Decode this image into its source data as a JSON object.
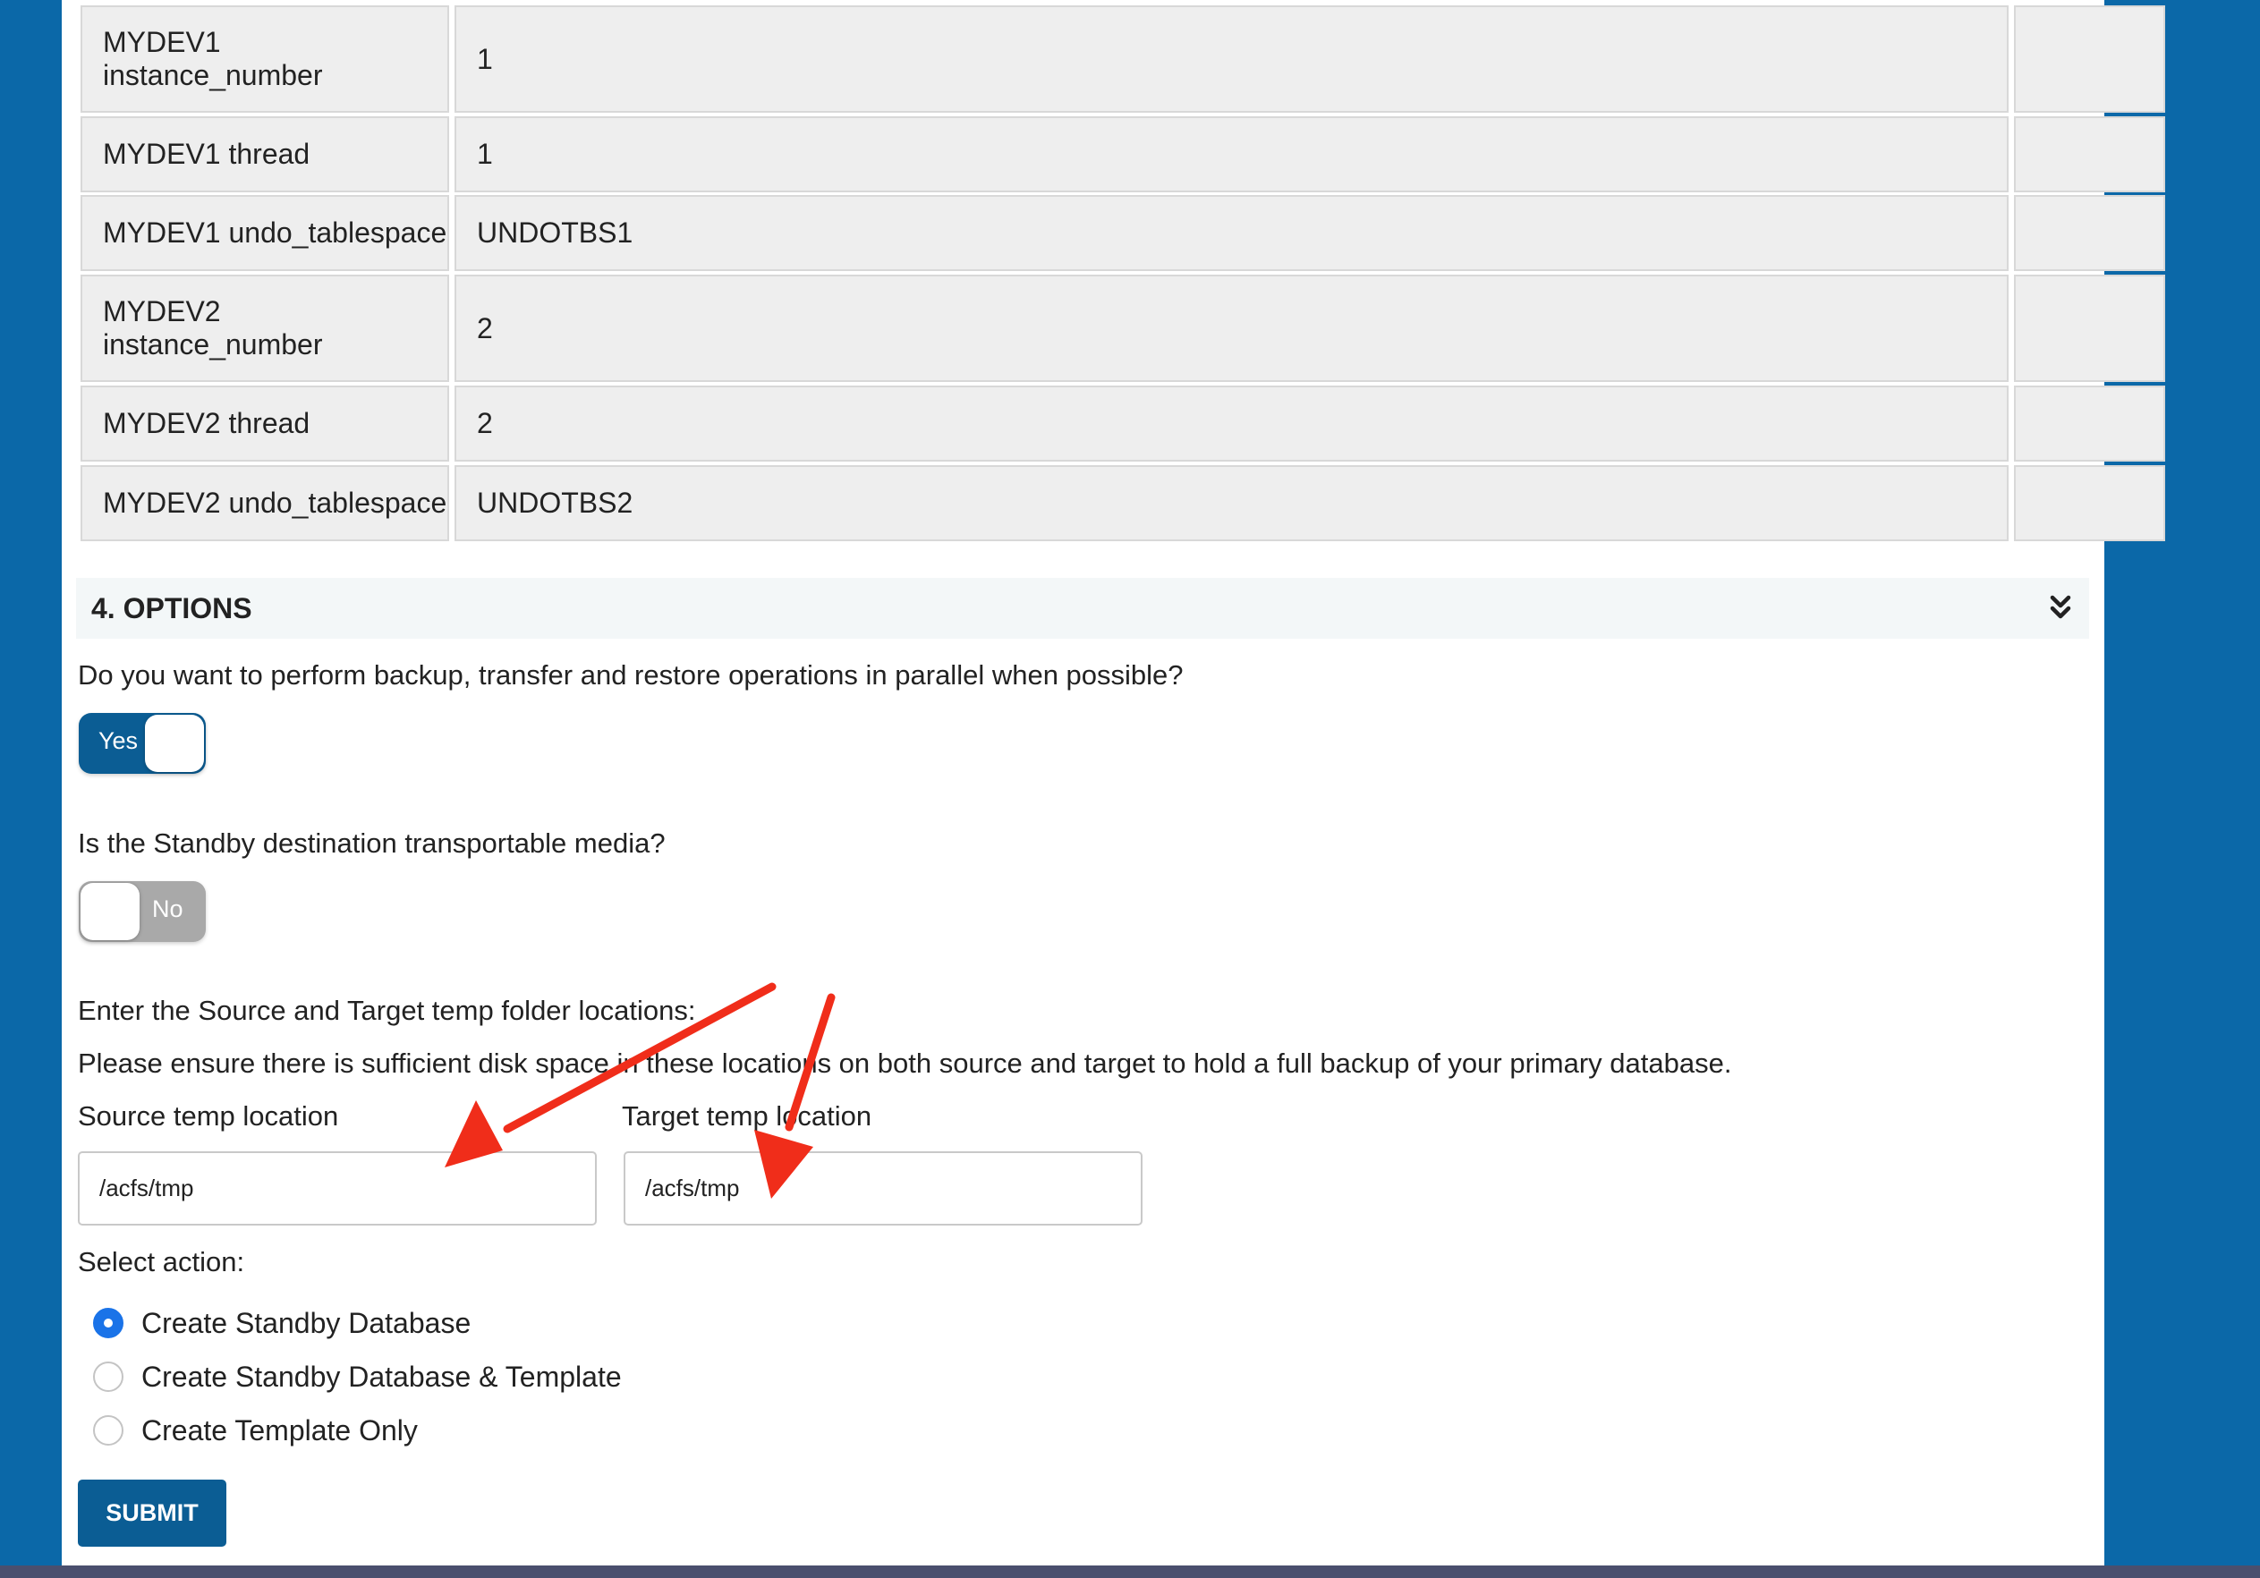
{
  "params": [
    {
      "name": "MYDEV1\ninstance_number",
      "value": "1"
    },
    {
      "name": "MYDEV1 thread",
      "value": "1"
    },
    {
      "name": "MYDEV1 undo_tablespace",
      "value": "UNDOTBS1"
    },
    {
      "name": "MYDEV2\ninstance_number",
      "value": "2"
    },
    {
      "name": "MYDEV2 thread",
      "value": "2"
    },
    {
      "name": "MYDEV2 undo_tablespace",
      "value": "UNDOTBS2"
    }
  ],
  "section": {
    "title": "4. OPTIONS",
    "icon": "double-chevron-down-icon"
  },
  "parallel": {
    "question": "Do you want to perform backup, transfer and restore operations in parallel when possible?",
    "toggle_label": "Yes",
    "state": "on"
  },
  "transportable": {
    "question": "Is the Standby destination transportable media?",
    "toggle_label": "No",
    "state": "off"
  },
  "temp": {
    "intro": "Enter the Source and Target temp folder locations:",
    "note": "Please ensure there is sufficient disk space in these locations on both source and target to hold a full backup of your primary database.",
    "source_label": "Source temp location",
    "source_value": "/acfs/tmp",
    "target_label": "Target temp location",
    "target_value": "/acfs/tmp"
  },
  "action": {
    "label": "Select action:",
    "options": [
      "Create Standby Database",
      "Create Standby Database & Template",
      "Create Template Only"
    ],
    "selected": "Create Standby Database"
  },
  "submit_label": "SUBMIT",
  "colors": {
    "brand": "#0b5d94",
    "background": "#0b68a8",
    "annotation_arrow": "#f02d1a",
    "radio_selected": "#1a73e8"
  }
}
